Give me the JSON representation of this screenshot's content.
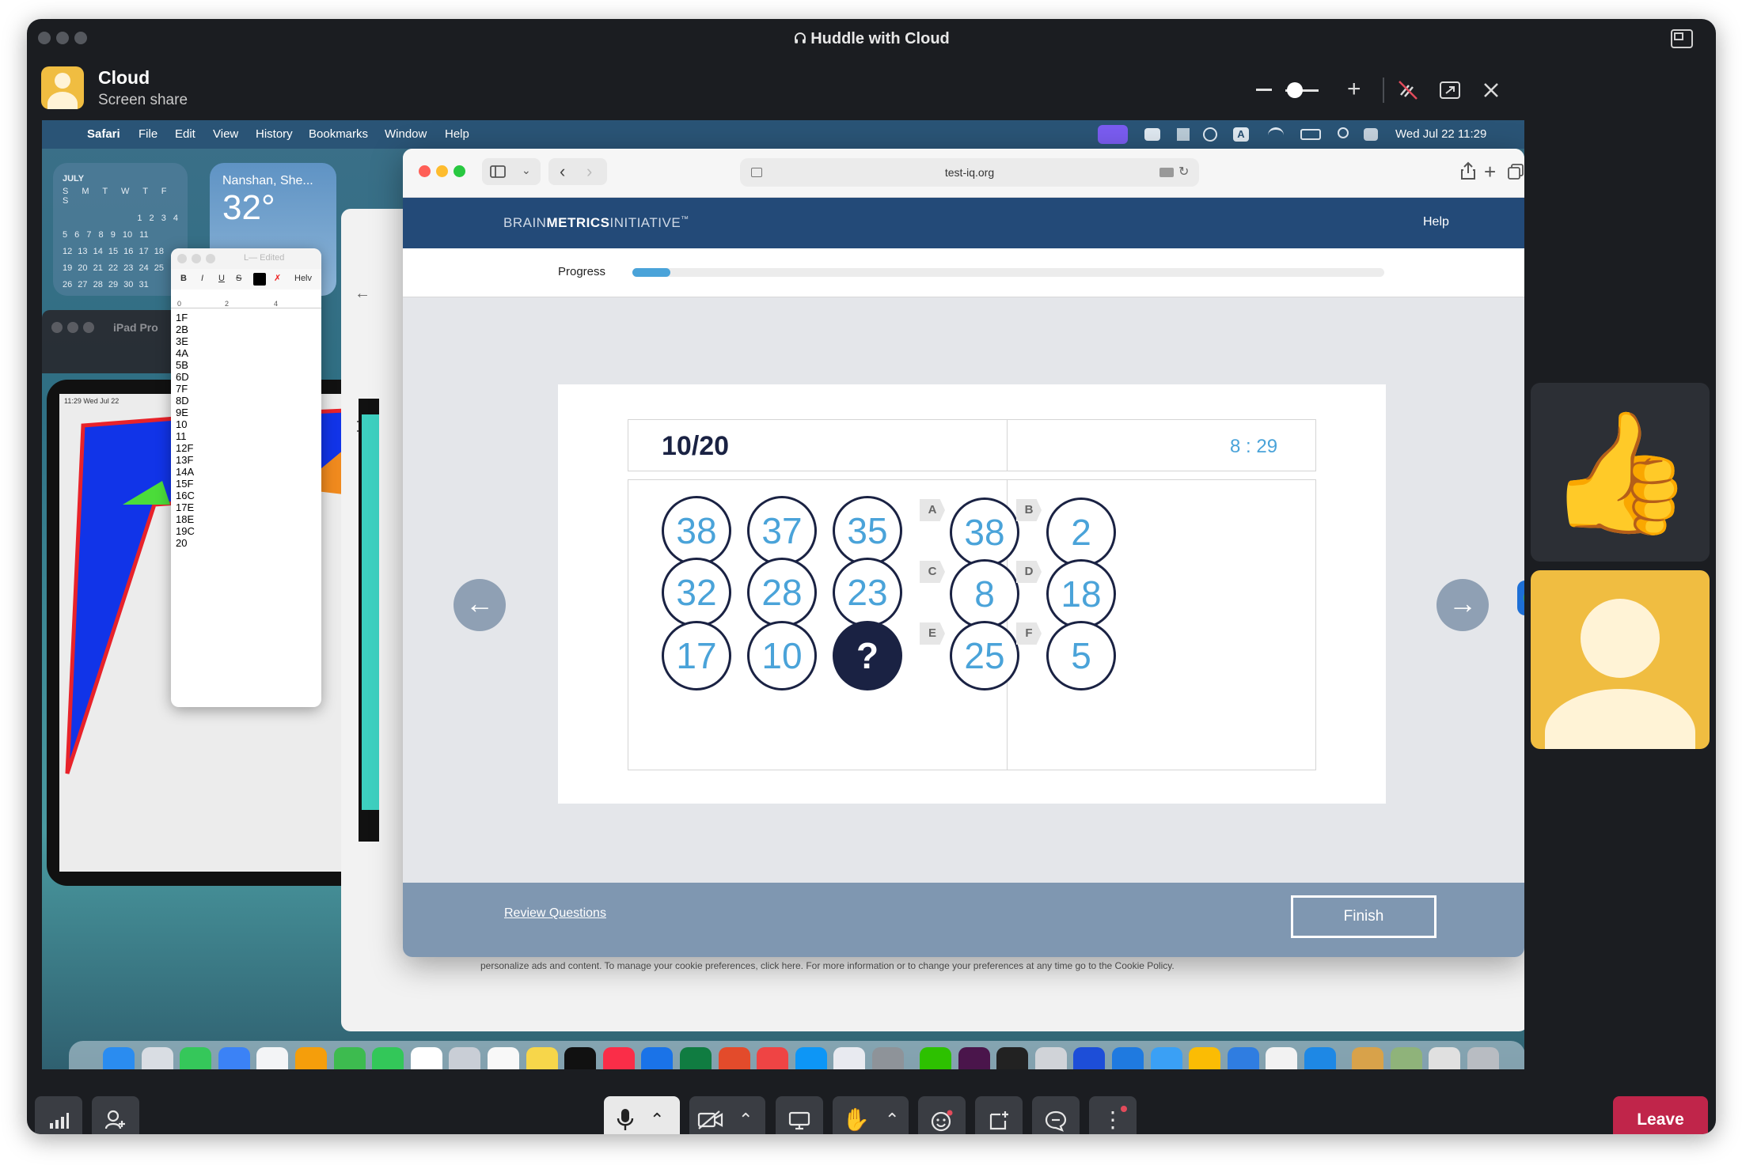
{
  "window": {
    "title": "Huddle with Cloud",
    "headphone_icon": "headphones-icon"
  },
  "presenter": {
    "name": "Cloud",
    "subtitle": "Screen share"
  },
  "mac": {
    "menubar": {
      "app": "Safari",
      "items": [
        "File",
        "Edit",
        "View",
        "History",
        "Bookmarks",
        "Window",
        "Help"
      ],
      "datetime": "Wed Jul 22  11:29"
    },
    "calendar_widget": {
      "month": "JULY",
      "weekdays": "S M T W T F S",
      "rows": [
        "1 2 3 4",
        "5 6 7 8 9 10 11",
        "12 13 14 15 16 17 18",
        "19 20 21 22 23 24 25",
        "26 27 28 29 30 31"
      ]
    },
    "weather_widget": {
      "location": "Nanshan, She...",
      "temp": "32°"
    },
    "textedit": {
      "title": "L— Edited",
      "font": "Helv",
      "ruler_marks": [
        "0",
        "2",
        "4"
      ],
      "lines": [
        "1F",
        "2B",
        "3E",
        "4A",
        "5B",
        "6D",
        "7F",
        "8D",
        "9E",
        "10",
        "11",
        "12F",
        "13F",
        "14A",
        "15F",
        "16C",
        "17E",
        "18E",
        "19C",
        "20"
      ]
    },
    "ipad_window": {
      "title": "iPad Pro",
      "status": "11:29  Wed Jul 22"
    },
    "cookie_text": "personalize ads and content. To manage your cookie preferences, click here. For more information or to change your preferences at any time go to the Cookie Policy."
  },
  "safari": {
    "url": "test-iq.org",
    "site": {
      "brand_light": "BRAIN",
      "brand_bold": "METRICS",
      "brand_tail": "INITIATIVE",
      "tm": "™",
      "help": "Help"
    },
    "progress": {
      "label": "Progress",
      "value": 0.05
    },
    "question": {
      "counter": "10/20",
      "timer": "8 : 29",
      "grid": [
        "38",
        "37",
        "35",
        "32",
        "28",
        "23",
        "17",
        "10",
        "?"
      ],
      "options": [
        {
          "letter": "A",
          "value": "38"
        },
        {
          "letter": "B",
          "value": "2"
        },
        {
          "letter": "C",
          "value": "8"
        },
        {
          "letter": "D",
          "value": "18"
        },
        {
          "letter": "E",
          "value": "25"
        },
        {
          "letter": "F",
          "value": "5"
        }
      ]
    },
    "footer": {
      "review": "Review Questions",
      "finish": "Finish"
    }
  },
  "participants": [
    {
      "name": "thumbs-up-reaction",
      "emoji": "👍"
    },
    {
      "name": "participant-avatar"
    }
  ],
  "toolbar": {
    "signal": "signal-icon",
    "add_person": "add-person-icon",
    "mic": "microphone-icon",
    "video_off": "video-off-icon",
    "screen": "screen-share-icon",
    "raise_hand": "✋",
    "emoji": "emoji-icon",
    "sticker": "sticker-icon",
    "chat": "chat-icon",
    "more": "⋮",
    "leave": "Leave"
  },
  "colors": {
    "leave": "#c0254a",
    "site_header": "#234a78",
    "accent": "#4aa3d9",
    "dark_circle": "#1a2243",
    "presenter_avatar": "#f0bd41"
  }
}
